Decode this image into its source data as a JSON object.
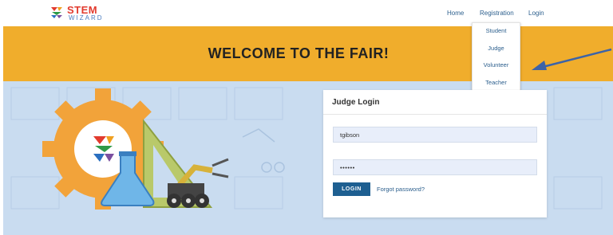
{
  "brand": {
    "logo_top": "STEM",
    "logo_bottom": "WIZARD",
    "logo_icon": "stem-wizard-logo-icon"
  },
  "nav": {
    "home": "Home",
    "registration": "Registration",
    "login": "Login"
  },
  "registration_menu": [
    "Student",
    "Judge",
    "Volunteer",
    "Teacher"
  ],
  "banner": {
    "title": "WELCOME TO THE FAIR!"
  },
  "login_card": {
    "title": "Judge Login",
    "username_value": "tgibson",
    "password_value": "••••••",
    "login_button": "LOGIN",
    "forgot_link": "Forgot password?"
  },
  "colors": {
    "banner": "#f0ad2c",
    "hero_bg": "#c9dcf0",
    "button": "#1e5f91",
    "link": "#2c5f8d",
    "arrow": "#3c63a8"
  }
}
